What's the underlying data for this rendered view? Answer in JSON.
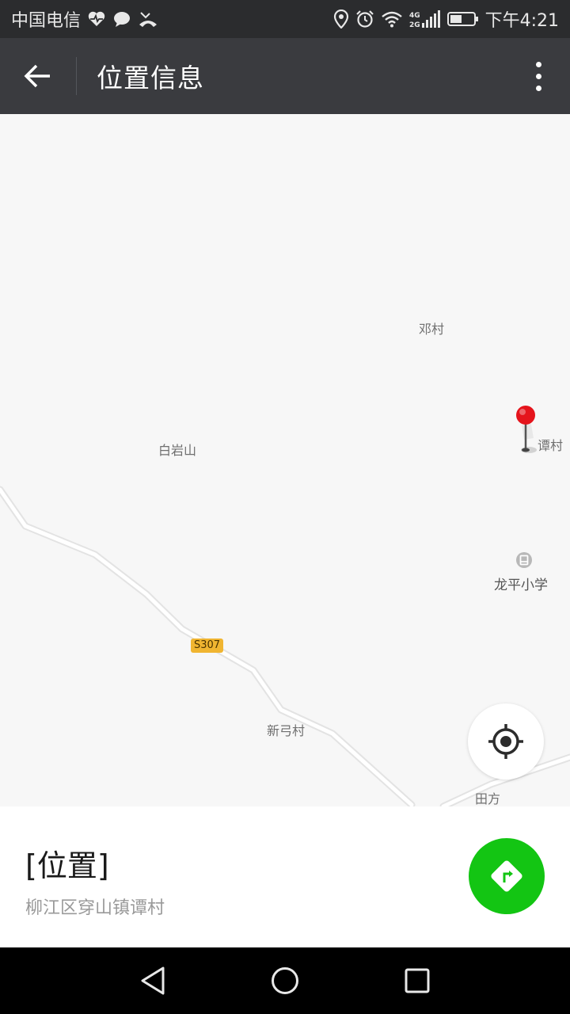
{
  "status_bar": {
    "carrier": "中国电信",
    "network": "4G 2G",
    "time": "下午4:21",
    "left_icons": [
      "heart-pulse-icon",
      "chat-bubble-icon",
      "missed-call-icon"
    ],
    "right_icons": [
      "location-icon",
      "alarm-icon",
      "wifi-icon",
      "signal-icon",
      "battery-icon"
    ]
  },
  "toolbar": {
    "back_icon": "arrow-left-icon",
    "title": "位置信息",
    "more_icon": "more-vertical-icon"
  },
  "map": {
    "labels": {
      "dengcun": "邓村",
      "tancun": "谭村",
      "baiyanshan": "白岩山",
      "longping_school": "龙平小学",
      "xingongcun": "新弓村",
      "tianfang": "田方"
    },
    "road_badge": "S307",
    "road_color": "#f0b531",
    "pin_color": "#e5141c",
    "locate_icon": "locate-crosshair-icon"
  },
  "place": {
    "name": "[位置]",
    "address": "柳江区穿山镇谭村",
    "nav_icon": "navigation-route-icon",
    "nav_color": "#13c513"
  },
  "nav_bar": {
    "back_icon": "triangle-back-icon",
    "home_icon": "circle-home-icon",
    "recents_icon": "square-recents-icon"
  }
}
